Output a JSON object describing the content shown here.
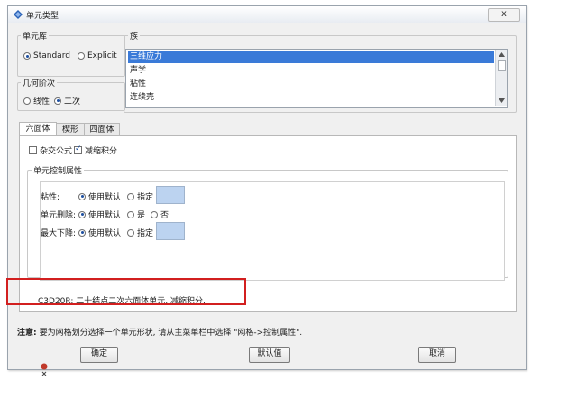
{
  "window": {
    "title": "单元类型",
    "close_symbol": "x"
  },
  "element_library": {
    "label": "单元库",
    "options": [
      {
        "label": "Standard",
        "selected": true
      },
      {
        "label": "Explicit",
        "selected": false
      }
    ]
  },
  "geometric_order": {
    "label": "几何阶次",
    "options": [
      {
        "label": "线性",
        "selected": false
      },
      {
        "label": "二次",
        "selected": true
      }
    ]
  },
  "family": {
    "label": "族",
    "items": [
      {
        "label": "三维应力",
        "selected": true
      },
      {
        "label": "声学",
        "selected": false
      },
      {
        "label": "粘性",
        "selected": false
      },
      {
        "label": "连续壳",
        "selected": false
      }
    ]
  },
  "tabs": [
    {
      "label": "六面体",
      "active": true
    },
    {
      "label": "楔形",
      "active": false
    },
    {
      "label": "四面体",
      "active": false
    }
  ],
  "options": {
    "hybrid": {
      "label": "杂交公式",
      "checked": false
    },
    "reduced": {
      "label": "减缩积分",
      "checked": true
    }
  },
  "controls": {
    "label": "单元控制属性",
    "rows": [
      {
        "label": "粘性:",
        "opt1": "使用默认",
        "opt2": "指定",
        "opt3": "",
        "has_swatch": true
      },
      {
        "label": "单元删除:",
        "opt1": "使用默认",
        "opt2": "是",
        "opt3": "否",
        "has_swatch": false
      },
      {
        "label": "最大下降:",
        "opt1": "使用默认",
        "opt2": "指定",
        "opt3": "",
        "has_swatch": true
      }
    ]
  },
  "description": "C3D20R:  二十结点二次六面体单元, 减缩积分.",
  "note": {
    "label": "注意:",
    "text": "要为网格划分选择一个单元形状, 请从主菜单栏中选择 \"网格->控制属性\"."
  },
  "buttons": {
    "ok": "确定",
    "defaults": "默认值",
    "cancel": "取消"
  },
  "colors": {
    "selection": "#3a7ad8",
    "highlight_box": "#d21f1f",
    "swatch": "#bcd3f0"
  }
}
